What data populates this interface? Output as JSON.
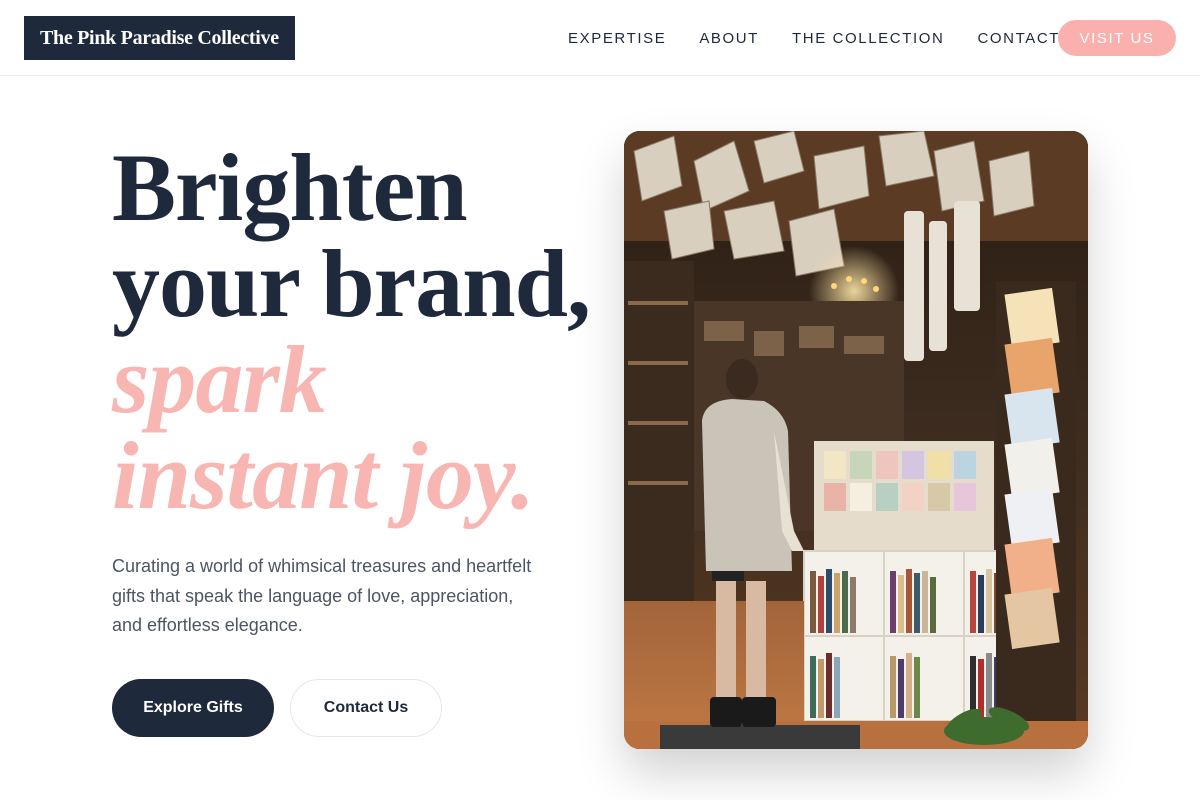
{
  "header": {
    "logo": "The Pink Paradise Collective",
    "nav": [
      "EXPERTISE",
      "ABOUT",
      "THE COLLECTION",
      "CONTACT"
    ],
    "cta": "VISIT US"
  },
  "hero": {
    "headline_lines": [
      "Brighten",
      "your brand,"
    ],
    "headline_accent_lines": [
      "spark",
      "instant joy."
    ],
    "subcopy": "Curating a world of whimsical treasures and heartfelt gifts that speak the language of love, appreciation, and effortless elegance.",
    "primary_button": "Explore Gifts",
    "secondary_button": "Contact Us",
    "image_alt": "Person browsing inside a bookshop with hanging books and greeting card racks"
  },
  "colors": {
    "navy": "#1e293b",
    "pink": "#f8b6b2",
    "cta_pink": "#fab1ad"
  }
}
